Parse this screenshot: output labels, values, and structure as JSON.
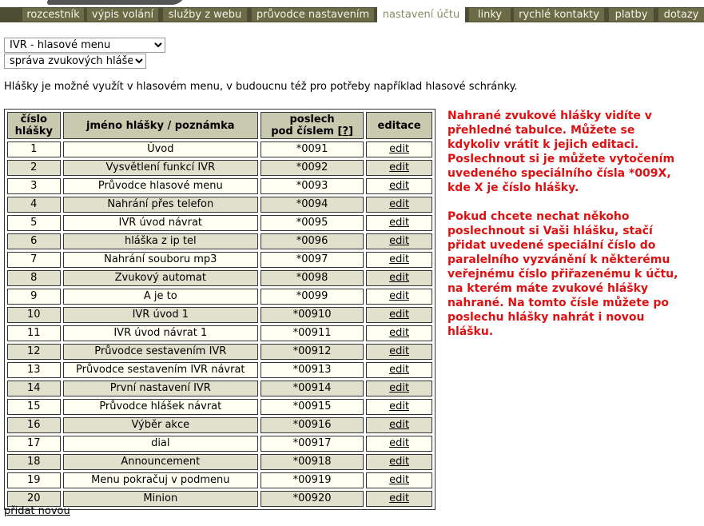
{
  "tabs": [
    "rozcestník",
    "výpis volání",
    "služby z webu",
    "průvodce nastavením",
    "nastavení účtu",
    "linky",
    "rychlé kontakty",
    "platby",
    "dotazy"
  ],
  "active_tab": "nastavení účtu",
  "selects": {
    "first_value": "IVR - hlasové menu",
    "second_value": "správa zvukových hlášek"
  },
  "intro_text": "Hlášky je možné využít v hlasovém menu, v budoucnu též pro potřeby například hlasové schránky.",
  "table": {
    "headers": {
      "number_line1": "číslo",
      "number_line2": "hlášky",
      "name": "jméno hlášky / poznámka",
      "listen_line1": "poslech",
      "listen_line2": "pod číslem",
      "help_link": "?",
      "edit": "editace"
    },
    "edit_label": "edit",
    "rows": [
      {
        "num": "1",
        "name": "Úvod",
        "code": "*0091"
      },
      {
        "num": "2",
        "name": "Vysvětlení funkcí IVR",
        "code": "*0092"
      },
      {
        "num": "3",
        "name": "Průvodce hlasové menu",
        "code": "*0093"
      },
      {
        "num": "4",
        "name": "Nahrání přes telefon",
        "code": "*0094"
      },
      {
        "num": "5",
        "name": "IVR úvod návrat",
        "code": "*0095"
      },
      {
        "num": "6",
        "name": "hláška z ip tel",
        "code": "*0096"
      },
      {
        "num": "7",
        "name": "Nahrání souboru mp3",
        "code": "*0097"
      },
      {
        "num": "8",
        "name": "Zvukový automat",
        "code": "*0098"
      },
      {
        "num": "9",
        "name": "A je to",
        "code": "*0099"
      },
      {
        "num": "10",
        "name": "IVR úvod 1",
        "code": "*00910"
      },
      {
        "num": "11",
        "name": "IVR úvod návrat 1",
        "code": "*00911"
      },
      {
        "num": "12",
        "name": "Průvodce sestavením IVR",
        "code": "*00912"
      },
      {
        "num": "13",
        "name": "Průvodce sestavením IVR návrat",
        "code": "*00913"
      },
      {
        "num": "14",
        "name": "První nastavení IVR",
        "code": "*00914"
      },
      {
        "num": "15",
        "name": "Průvodce hlášek návrat",
        "code": "*00915"
      },
      {
        "num": "16",
        "name": "Výběr akce",
        "code": "*00916"
      },
      {
        "num": "17",
        "name": "dial",
        "code": "*00917"
      },
      {
        "num": "18",
        "name": "Announcement",
        "code": "*00918"
      },
      {
        "num": "19",
        "name": "Menu pokračuj v podmenu",
        "code": "*00919"
      },
      {
        "num": "20",
        "name": "Minion",
        "code": "*00920"
      }
    ]
  },
  "note_paragraphs": [
    "Nahrané zvukové hlášky vidíte v přehledné tabulce. Můžete se kdykoliv vrátit k jejich editaci. Poslechnout si je můžete vytočením uvedeného speciálního čísla *009X, kde X je číslo hlášky.",
    "Pokud chcete nechat někoho poslechnout si Vaši hlášku, stačí přidat uvedené speciální číslo do paralelního vyzvánění k některému veřejnému číslo přiřazenému k účtu, na kterém máte zvukové hlášky nahrané.  Na tomto čísle můžete po poslechu hlášky nahrát i novou hlášku."
  ],
  "add_new_label": "přidat novou",
  "colors": {
    "tabbar": "#4d4d33",
    "tab": "#6b6b47",
    "header_cell": "#c9c9b0",
    "row_even": "#e0e0cc",
    "row_odd": "#fffff2",
    "note_text": "#dd1111"
  }
}
